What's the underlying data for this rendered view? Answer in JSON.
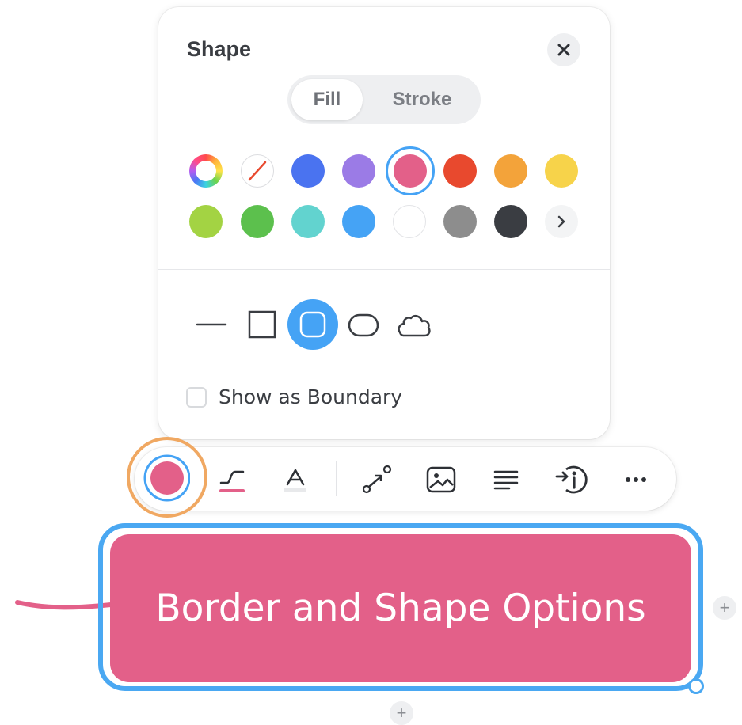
{
  "panel": {
    "title": "Shape",
    "close_icon": "close-icon",
    "tabs": [
      {
        "label": "Fill",
        "active": true
      },
      {
        "label": "Stroke",
        "active": false
      }
    ],
    "colors": {
      "row1": [
        "rainbow-picker",
        "none",
        "#4a73f0",
        "#9b7be6",
        "#e36089",
        "#e8492e",
        "#f3a33a",
        "#f7d34a"
      ],
      "row2": [
        "#a3d343",
        "#5cc04d",
        "#62d3cf",
        "#45a3f5",
        "#ffffff",
        "#8d8d8d",
        "#3a3d42",
        "more"
      ],
      "selected": "#e36089"
    },
    "shapes": [
      "line-shape-icon",
      "square-shape-icon",
      "rounded-rect-shape-icon",
      "capsule-shape-icon",
      "cloud-shape-icon"
    ],
    "selected_shape": "rounded-rect-shape-icon",
    "show_as_boundary": {
      "label": "Show as Boundary",
      "checked": false
    }
  },
  "toolbar": {
    "items": [
      "fill-color-icon",
      "line-style-icon",
      "text-format-icon",
      "relationship-icon",
      "image-icon",
      "align-icon",
      "insert-icon",
      "more-icon"
    ],
    "fill_color": "#e36089",
    "accent": "#e36089"
  },
  "node": {
    "text": "Border and Shape Options",
    "fill": "#e36089",
    "border": "#4aa8f2"
  },
  "add_labels": {
    "right": "+",
    "bottom": "+"
  }
}
